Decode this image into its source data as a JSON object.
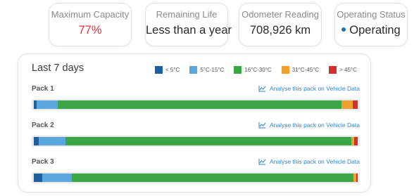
{
  "stats": [
    {
      "label": "Maximum Capacity",
      "value": "77%"
    },
    {
      "label": "Remaining Life",
      "value": "Less than a year"
    },
    {
      "label": "Odometer Reading",
      "value": "708,926 km"
    },
    {
      "label": "Operating Status",
      "value": "Operating"
    }
  ],
  "colors": {
    "capacity_value": "#d9343a",
    "status_dot": "#1f6fb4",
    "link": "#2a86c8"
  },
  "panel": {
    "title": "Last 7 days",
    "legend": [
      {
        "label": "< 5°C",
        "color": "#1f5f9e"
      },
      {
        "label": "5°C-15°C",
        "color": "#5aa7df"
      },
      {
        "label": "16°C-30°C",
        "color": "#3aa646"
      },
      {
        "label": "31°C-45°C",
        "color": "#f0a030"
      },
      {
        "label": "> 45°C",
        "color": "#d32f2f"
      }
    ],
    "packs": [
      {
        "name": "Pack 1",
        "link_label": "Analyse this pack on Vehicle Data",
        "distribution": [
          0.8,
          6.6,
          86.7,
          3.6,
          1.4
        ]
      },
      {
        "name": "Pack 2",
        "link_label": "Analyse this pack on Vehicle Data",
        "distribution": [
          1.6,
          8.1,
          88.1,
          1.0,
          1.0
        ]
      },
      {
        "name": "Pack 3",
        "link_label": "Analyse this pack on Vehicle Data",
        "distribution": [
          2.5,
          9.3,
          86.7,
          0.7,
          0.5
        ]
      }
    ]
  }
}
